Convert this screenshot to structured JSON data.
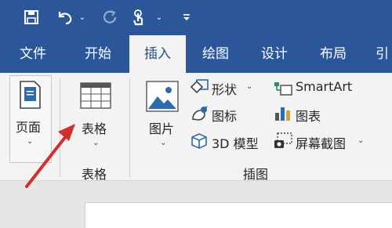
{
  "tabs": [
    "文件",
    "开始",
    "插入",
    "绘图",
    "设计",
    "布局",
    "引"
  ],
  "active_tab": "插入",
  "ribbon": {
    "pages": {
      "label": "页面"
    },
    "tables": {
      "button_label": "表格",
      "group_label": "表格"
    },
    "illustrations": {
      "pictures_label": "图片",
      "shapes_label": "形状",
      "icons_label": "图标",
      "models3d_label": "3D 模型",
      "smartart_label": "SmartArt",
      "chart_label": "图表",
      "screenshot_label": "屏幕截图",
      "group_label": "插图"
    }
  },
  "colors": {
    "brand": "#2b579a",
    "annotation_arrow": "#d32f2f"
  }
}
